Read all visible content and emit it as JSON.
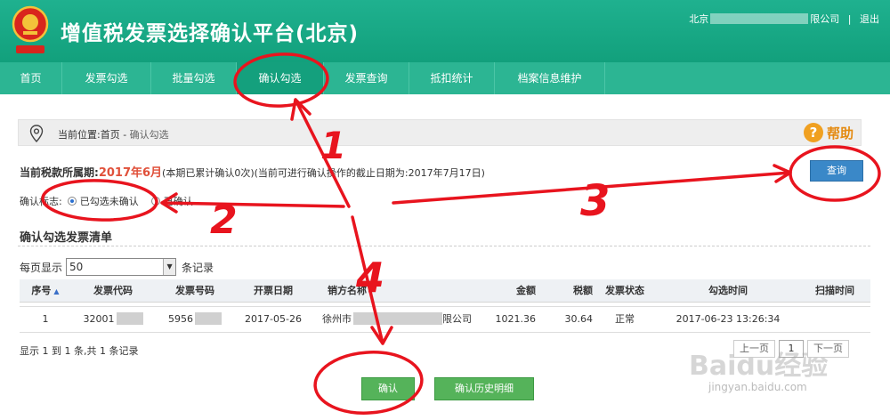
{
  "header": {
    "title": "增值税发票选择确认平台(北京)",
    "user_prefix": "北京",
    "user_suffix": "限公司",
    "logout_label": "退出",
    "separator": "|"
  },
  "nav": {
    "items": [
      {
        "label": "首页"
      },
      {
        "label": "发票勾选"
      },
      {
        "label": "批量勾选"
      },
      {
        "label": "确认勾选"
      },
      {
        "label": "发票查询"
      },
      {
        "label": "抵扣统计"
      },
      {
        "label": "档案信息维护"
      }
    ],
    "active_index": 3
  },
  "breadcrumb": {
    "prefix": "当前位置:首页 - ",
    "current": "确认勾选"
  },
  "help": {
    "icon_glyph": "?",
    "label": "帮助"
  },
  "period": {
    "label": "当前税款所属期:",
    "value": "2017年6月",
    "note": "(本期已累计确认0次)(当前可进行确认操作的截止日期为:2017年7月17日)"
  },
  "query_button": "查询",
  "confirm_status": {
    "label": "确认标志:",
    "options": [
      {
        "label": "已勾选未确认",
        "checked": true
      },
      {
        "label": "已确认",
        "checked": false
      }
    ]
  },
  "list": {
    "title": "确认勾选发票清单",
    "per_page_prefix": "每页显示",
    "per_page_value": "50",
    "per_page_suffix": "条记录",
    "columns": [
      "序号",
      "发票代码",
      "发票号码",
      "开票日期",
      "销方名称",
      "金额",
      "税额",
      "发票状态",
      "勾选时间",
      "扫描时间"
    ],
    "rows": [
      {
        "index": "1",
        "code": "32001",
        "number": "5956",
        "date": "2017-05-26",
        "seller_prefix": "徐州市",
        "seller_suffix": "限公司",
        "amount": "1021.36",
        "tax": "30.64",
        "status": "正常",
        "check_time": "2017-06-23 13:26:34",
        "scan_time": ""
      }
    ],
    "summary": "显示 1 到 1 条,共 1 条记录"
  },
  "pager": {
    "prev": "上一页",
    "page": "1",
    "next": "下一页"
  },
  "actions": {
    "confirm": "确认",
    "history": "确认历史明细"
  },
  "watermark": {
    "text": "Baidu经验",
    "sub": "jingyan.baidu.com"
  },
  "annotations": {
    "n1": "1",
    "n2": "2",
    "n3": "3",
    "n4": "4"
  },
  "colors": {
    "brand": "#16a085",
    "nav": "#2cb593",
    "annotation": "#e8141e",
    "query": "#3a88c8",
    "confirm": "#55b35a",
    "period_value": "#e0503a"
  }
}
